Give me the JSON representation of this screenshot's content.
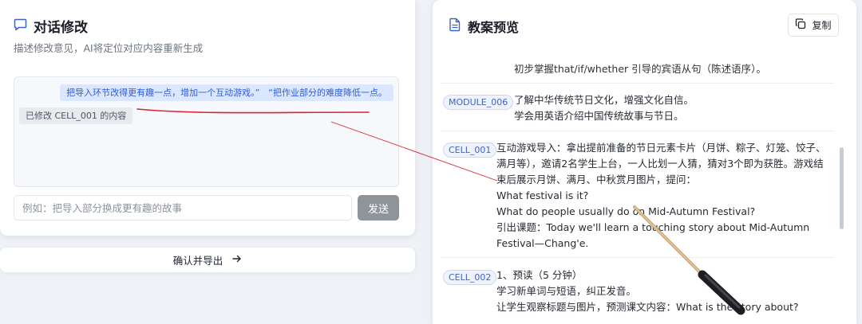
{
  "left_panel": {
    "title": "对话修改",
    "title_icon": "chat-bubble-icon",
    "subtitle": "描述修改意见，AI将定位对应内容重新生成",
    "messages": {
      "user": "把导入环节改得更有趣一点，增加一个互动游戏。”　“把作业部分的难度降低一点。",
      "system": "已修改 CELL_001 的内容"
    },
    "input": {
      "placeholder": "例如：把导入部分换成更有趣的故事",
      "value": ""
    },
    "send_label": "发送",
    "confirm_label": "确认并导出",
    "confirm_icon": "arrow-right-icon"
  },
  "right_panel": {
    "title": "教案预览",
    "title_icon": "document-icon",
    "copy_label": "复制",
    "copy_icon": "copy-icon",
    "truncated_line": "初步掌握that/if/whether 引导的宾语从句（陈述语序）。",
    "items": [
      {
        "badge": "MODULE_006",
        "lines": [
          "了解中华传统节日文化，增强文化自信。",
          "学会用英语介绍中国传统故事与节日。"
        ]
      },
      {
        "badge": "CELL_001",
        "lines": [
          "互动游戏导入：拿出提前准备的节日元素卡片（月饼、粽子、灯笼、饺子、满月等），邀请2名学生上台，一人比划一人猜，猜对3个即为获胜。游戏结束后展示月饼、满月、中秋赏月图片，提问：",
          "What festival is it?",
          "What do people usually do on Mid-Autumn Festival?",
          "引出课题：Today we'll learn a touching story about Mid-Autumn Festival—Chang'e."
        ]
      },
      {
        "badge": "CELL_002",
        "lines": [
          "1、预读（5 分钟）",
          "学习新单词与短语，纠正发音。",
          "让学生观察标题与图片，预测课文内容：What is the story about?"
        ]
      }
    ]
  },
  "colors": {
    "accent": "#3b63c8",
    "user_bubble": "#dbe7ff",
    "system_bubble": "#e8eaee",
    "send_button": "#8f939a",
    "annotation_red": "#d9232e",
    "background": "#eef1f6"
  },
  "annotations": {
    "underline_color": "#d9232e",
    "pointer": "pointer-stick"
  }
}
